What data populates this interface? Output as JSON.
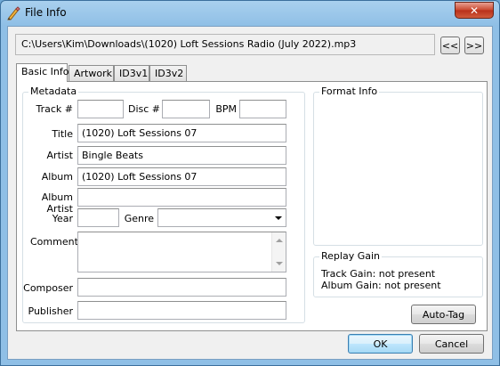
{
  "window": {
    "title": "File Info",
    "close_label": "✕"
  },
  "file_path": "C:\\Users\\Kim\\Downloads\\(1020) Loft Sessions Radio (July 2022).mp3",
  "nav": {
    "prev_label": "<<",
    "next_label": ">>"
  },
  "tabs": [
    {
      "label": "Basic Info",
      "active": true
    },
    {
      "label": "Artwork"
    },
    {
      "label": "ID3v1"
    },
    {
      "label": "ID3v2"
    }
  ],
  "metadata": {
    "group_label": "Metadata",
    "track_label": "Track #",
    "track_value": "",
    "disc_label": "Disc #",
    "disc_value": "",
    "bpm_label": "BPM",
    "bpm_value": "",
    "title_label": "Title",
    "title_value": "(1020) Loft Sessions 07",
    "artist_label": "Artist",
    "artist_value": "Bingle Beats",
    "album_label": "Album",
    "album_value": "(1020) Loft Sessions 07",
    "album_artist_label": "Album Artist",
    "album_artist_value": "",
    "year_label": "Year",
    "year_value": "",
    "genre_label": "Genre",
    "genre_value": "",
    "comment_label": "Comment",
    "comment_value": "",
    "composer_label": "Composer",
    "composer_value": "",
    "publisher_label": "Publisher",
    "publisher_value": ""
  },
  "format_info": {
    "group_label": "Format Info"
  },
  "replay_gain": {
    "group_label": "Replay Gain",
    "track_gain": "Track Gain: not present",
    "album_gain": "Album Gain: not present"
  },
  "buttons": {
    "auto_tag": "Auto-Tag",
    "ok": "OK",
    "cancel": "Cancel"
  },
  "icons": {
    "app": "pencil-edit-icon",
    "close": "close-icon"
  },
  "colors": {
    "title_bar": "#8fbfe6",
    "close_button": "#c9462c",
    "default_button_border": "#3c7fb1"
  }
}
